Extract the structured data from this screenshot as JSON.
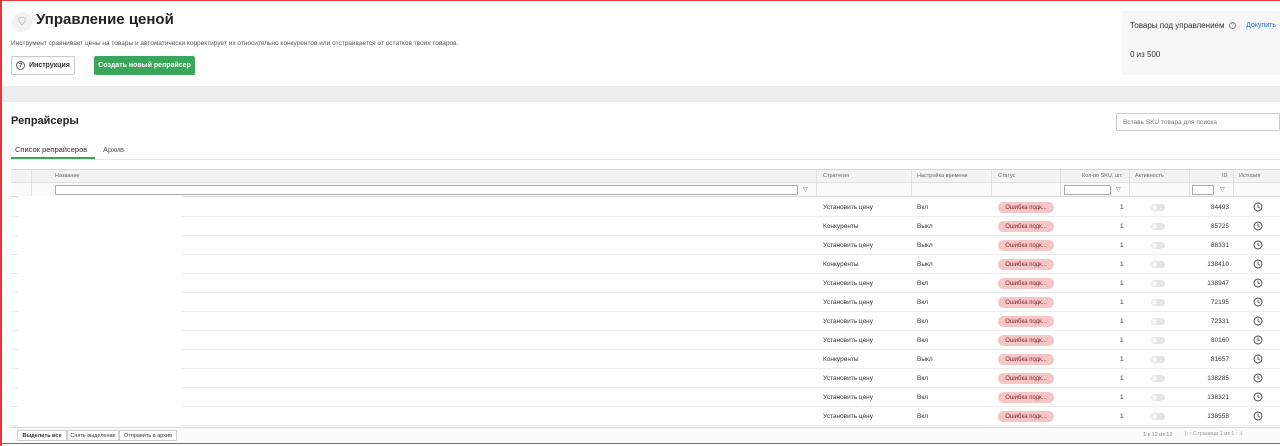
{
  "header": {
    "title": "Управление ценой",
    "description": "Инструмент сравнивает цены на товары и автоматически корректирует их относительно конкурентов или отстраивается от остатков твоих товаров.",
    "instruction_label": "Инструкция",
    "create_label": "Создать новый репрайсер"
  },
  "managed": {
    "title": "Товары под управлением",
    "buy_label": "Докупить",
    "count": "0 из 500"
  },
  "section": {
    "title": "Репрайсеры",
    "search_placeholder": "Вставь SKU товара для поиска"
  },
  "tabs": [
    {
      "label": "Список репрайсеров",
      "active": true
    },
    {
      "label": "Архив",
      "active": false
    }
  ],
  "table": {
    "columns": {
      "name": "Название",
      "strategy": "Стратегия",
      "time": "Настройка времени",
      "status": "Статус",
      "sku": "Кол-во SKU, шт.",
      "activity": "Активность",
      "id": "ID",
      "history": "История"
    },
    "rows": [
      {
        "strategy": "Установить цену",
        "time": "Вкл",
        "status": "Ошибка подк...",
        "sku": "1",
        "id": "84493"
      },
      {
        "strategy": "Конкуренты",
        "time": "Выкл",
        "status": "Ошибка подк...",
        "sku": "1",
        "id": "85725"
      },
      {
        "strategy": "Установить цену",
        "time": "Выкл",
        "status": "Ошибка подк...",
        "sku": "1",
        "id": "88331"
      },
      {
        "strategy": "Конкуренты",
        "time": "Выкл",
        "status": "Ошибка подк...",
        "sku": "1",
        "id": "138410"
      },
      {
        "strategy": "Установить цену",
        "time": "Вкл",
        "status": "Ошибка подк...",
        "sku": "1",
        "id": "138947"
      },
      {
        "strategy": "Установить цену",
        "time": "Вкл",
        "status": "Ошибка подк...",
        "sku": "1",
        "id": "72195"
      },
      {
        "strategy": "Установить цену",
        "time": "Вкл",
        "status": "Ошибка подк...",
        "sku": "1",
        "id": "72331"
      },
      {
        "strategy": "Установить цену",
        "time": "Вкл",
        "status": "Ошибка подк...",
        "sku": "1",
        "id": "80160"
      },
      {
        "strategy": "Конкуренты",
        "time": "Выкл",
        "status": "Ошибка подк...",
        "sku": "1",
        "id": "81657"
      },
      {
        "strategy": "Установить цену",
        "time": "Вкл",
        "status": "Ошибка подк...",
        "sku": "1",
        "id": "138285"
      },
      {
        "strategy": "Установить цену",
        "time": "Вкл",
        "status": "Ошибка подк...",
        "sku": "1",
        "id": "138321"
      },
      {
        "strategy": "Установить цену",
        "time": "Вкл",
        "status": "Ошибка подк...",
        "sku": "1",
        "id": "138558"
      }
    ]
  },
  "footer": {
    "select_all": "Выделить все",
    "deselect": "Снять выделение",
    "archive": "Отправить в архив",
    "pager_info": "1 к 12 из 12",
    "pager_nav": "|‹  ‹  Страница 1 из 1  ›  ›|"
  },
  "colors": {
    "accent_green": "#3aa65a",
    "status_error_bg": "#f6c5c5",
    "link_blue": "#1e6fd0",
    "frame_red": "#e53935"
  },
  "icons": {
    "logo": "tag-icon",
    "instruction": "question-circle-icon",
    "history": "clock-icon",
    "filter": "filter-icon"
  }
}
